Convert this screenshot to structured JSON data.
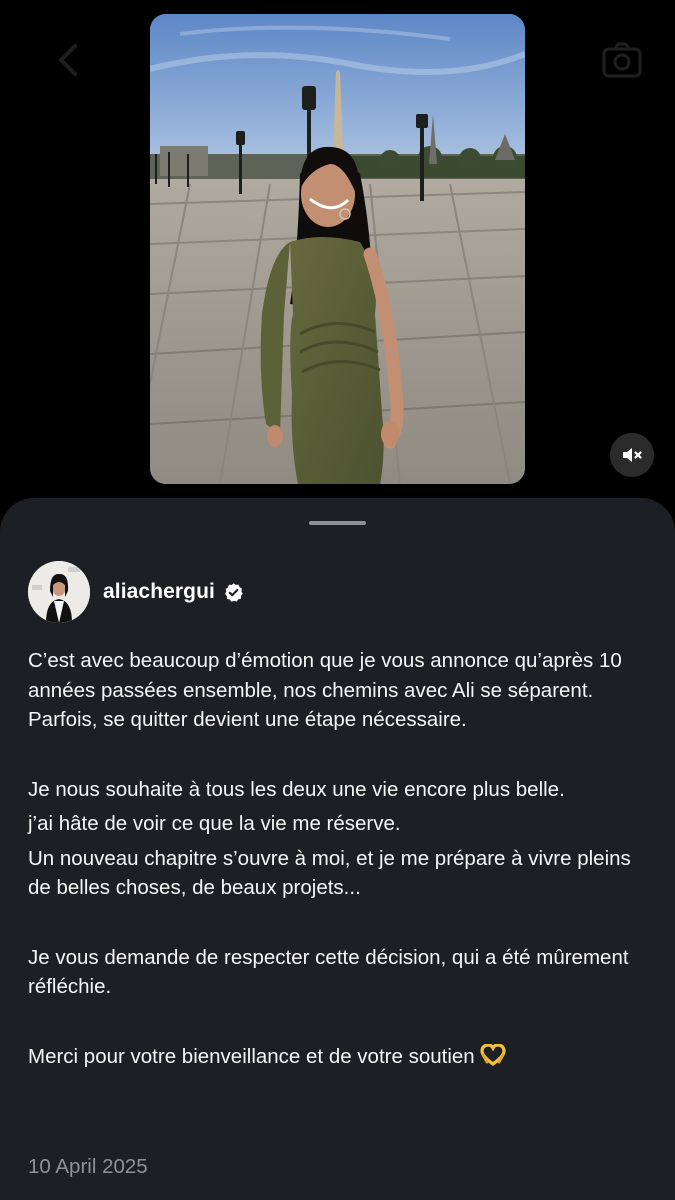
{
  "header": {
    "back_icon": "chevron-left-icon",
    "camera_icon": "camera-icon"
  },
  "media": {
    "description_icon": "photo",
    "mute_icon": "speaker-muted-icon"
  },
  "post": {
    "username": "aliachergui",
    "verified": true,
    "caption": {
      "p1": "C’est avec beaucoup d’émotion que je vous annonce qu’après 10 années passées ensemble, nos chemins avec Ali se séparent. Parfois, se quitter devient une étape nécessaire.",
      "p2": "Je nous souhaite à tous les deux une vie encore plus belle.",
      "p3": "j’ai hâte de voir ce que la vie me réserve.",
      "p4": "Un nouveau chapitre s’ouvre à moi, et je me prépare à vivre pleins de belles choses, de beaux projets...",
      "p5": "Je vous demande de respecter cette décision, qui a été mûrement réfléchie.",
      "p6": "Merci pour votre bienveillance et de votre soutien"
    },
    "date": "10 April 2025"
  },
  "colors": {
    "background": "#000000",
    "sheet": "#1c1f24",
    "text": "#f5f5f5",
    "muted_text": "#8e9196",
    "verified_badge": "#ffffff",
    "emoji": "#f3c23d"
  }
}
